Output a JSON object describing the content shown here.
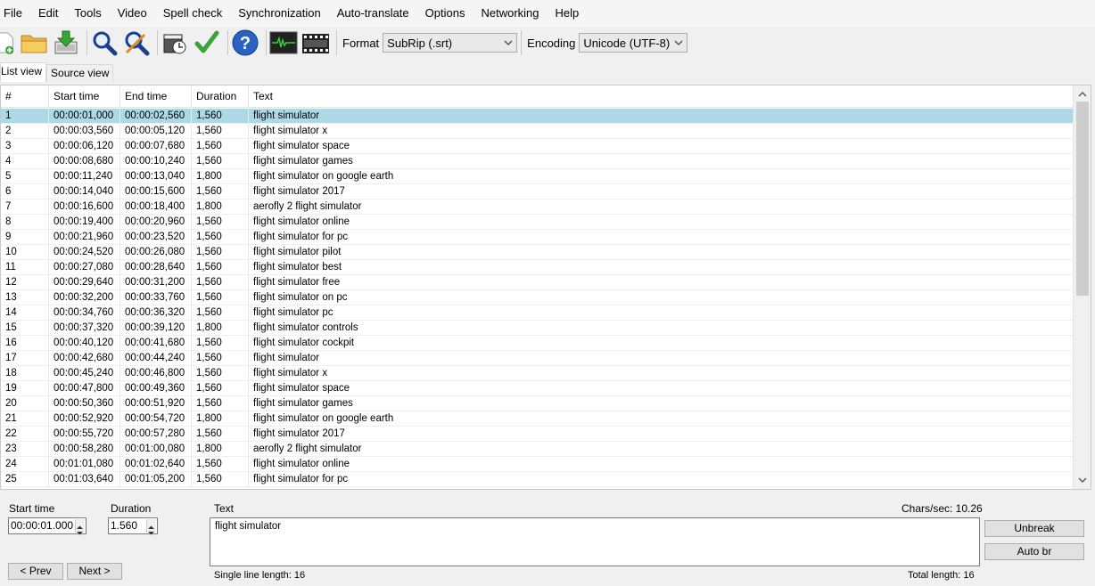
{
  "menu": [
    "File",
    "Edit",
    "Tools",
    "Video",
    "Spell check",
    "Synchronization",
    "Auto-translate",
    "Options",
    "Networking",
    "Help"
  ],
  "toolbar": {
    "format_label": "Format",
    "format_value": "SubRip (.srt)",
    "encoding_label": "Encoding",
    "encoding_value": "Unicode (UTF-8)"
  },
  "tabs": [
    "List view",
    "Source view"
  ],
  "columns": [
    "#",
    "Start time",
    "End time",
    "Duration",
    "Text"
  ],
  "rows": [
    [
      "1",
      "00:00:01,000",
      "00:00:02,560",
      "1,560",
      "flight simulator"
    ],
    [
      "2",
      "00:00:03,560",
      "00:00:05,120",
      "1,560",
      "flight simulator x"
    ],
    [
      "3",
      "00:00:06,120",
      "00:00:07,680",
      "1,560",
      "flight simulator space"
    ],
    [
      "4",
      "00:00:08,680",
      "00:00:10,240",
      "1,560",
      "flight simulator games"
    ],
    [
      "5",
      "00:00:11,240",
      "00:00:13,040",
      "1,800",
      "flight simulator on google earth"
    ],
    [
      "6",
      "00:00:14,040",
      "00:00:15,600",
      "1,560",
      "flight simulator 2017"
    ],
    [
      "7",
      "00:00:16,600",
      "00:00:18,400",
      "1,800",
      "aerofly 2 flight simulator"
    ],
    [
      "8",
      "00:00:19,400",
      "00:00:20,960",
      "1,560",
      "flight simulator online"
    ],
    [
      "9",
      "00:00:21,960",
      "00:00:23,520",
      "1,560",
      "flight simulator for pc"
    ],
    [
      "10",
      "00:00:24,520",
      "00:00:26,080",
      "1,560",
      "flight simulator pilot"
    ],
    [
      "11",
      "00:00:27,080",
      "00:00:28,640",
      "1,560",
      "flight simulator best"
    ],
    [
      "12",
      "00:00:29,640",
      "00:00:31,200",
      "1,560",
      "flight simulator free"
    ],
    [
      "13",
      "00:00:32,200",
      "00:00:33,760",
      "1,560",
      "flight simulator on pc"
    ],
    [
      "14",
      "00:00:34,760",
      "00:00:36,320",
      "1,560",
      "flight simulator pc"
    ],
    [
      "15",
      "00:00:37,320",
      "00:00:39,120",
      "1,800",
      "flight simulator controls"
    ],
    [
      "16",
      "00:00:40,120",
      "00:00:41,680",
      "1,560",
      "flight simulator cockpit"
    ],
    [
      "17",
      "00:00:42,680",
      "00:00:44,240",
      "1,560",
      "flight simulator"
    ],
    [
      "18",
      "00:00:45,240",
      "00:00:46,800",
      "1,560",
      "flight simulator x"
    ],
    [
      "19",
      "00:00:47,800",
      "00:00:49,360",
      "1,560",
      "flight simulator space"
    ],
    [
      "20",
      "00:00:50,360",
      "00:00:51,920",
      "1,560",
      "flight simulator games"
    ],
    [
      "21",
      "00:00:52,920",
      "00:00:54,720",
      "1,800",
      "flight simulator on google earth"
    ],
    [
      "22",
      "00:00:55,720",
      "00:00:57,280",
      "1,560",
      "flight simulator 2017"
    ],
    [
      "23",
      "00:00:58,280",
      "00:01:00,080",
      "1,800",
      "aerofly 2 flight simulator"
    ],
    [
      "24",
      "00:01:01,080",
      "00:01:02,640",
      "1,560",
      "flight simulator online"
    ],
    [
      "25",
      "00:01:03,640",
      "00:01:05,200",
      "1,560",
      "flight simulator for pc"
    ]
  ],
  "selected_row": 0,
  "editor": {
    "start_time_label": "Start time",
    "start_time_value": "00:00:01.000",
    "duration_label": "Duration",
    "duration_value": "1.560",
    "text_label": "Text",
    "text_value": "flight simulator",
    "chars_sec": "Chars/sec: 10.26",
    "single_line_length": "Single line length:  16",
    "total_length": "Total length: 16",
    "unbreak_label": "Unbreak",
    "auto_br_label": "Auto br",
    "prev_label": "< Prev",
    "next_label": "Next >"
  },
  "colors": {
    "selected_row": "#add8e6",
    "window_bg": "#f0f0f0"
  },
  "icons": [
    "new-file-icon",
    "open-folder-icon",
    "save-download-icon",
    "find-icon",
    "replace-icon",
    "visual-sync-icon",
    "spell-check-icon",
    "help-icon",
    "waveform-icon",
    "video-clapper-icon"
  ]
}
